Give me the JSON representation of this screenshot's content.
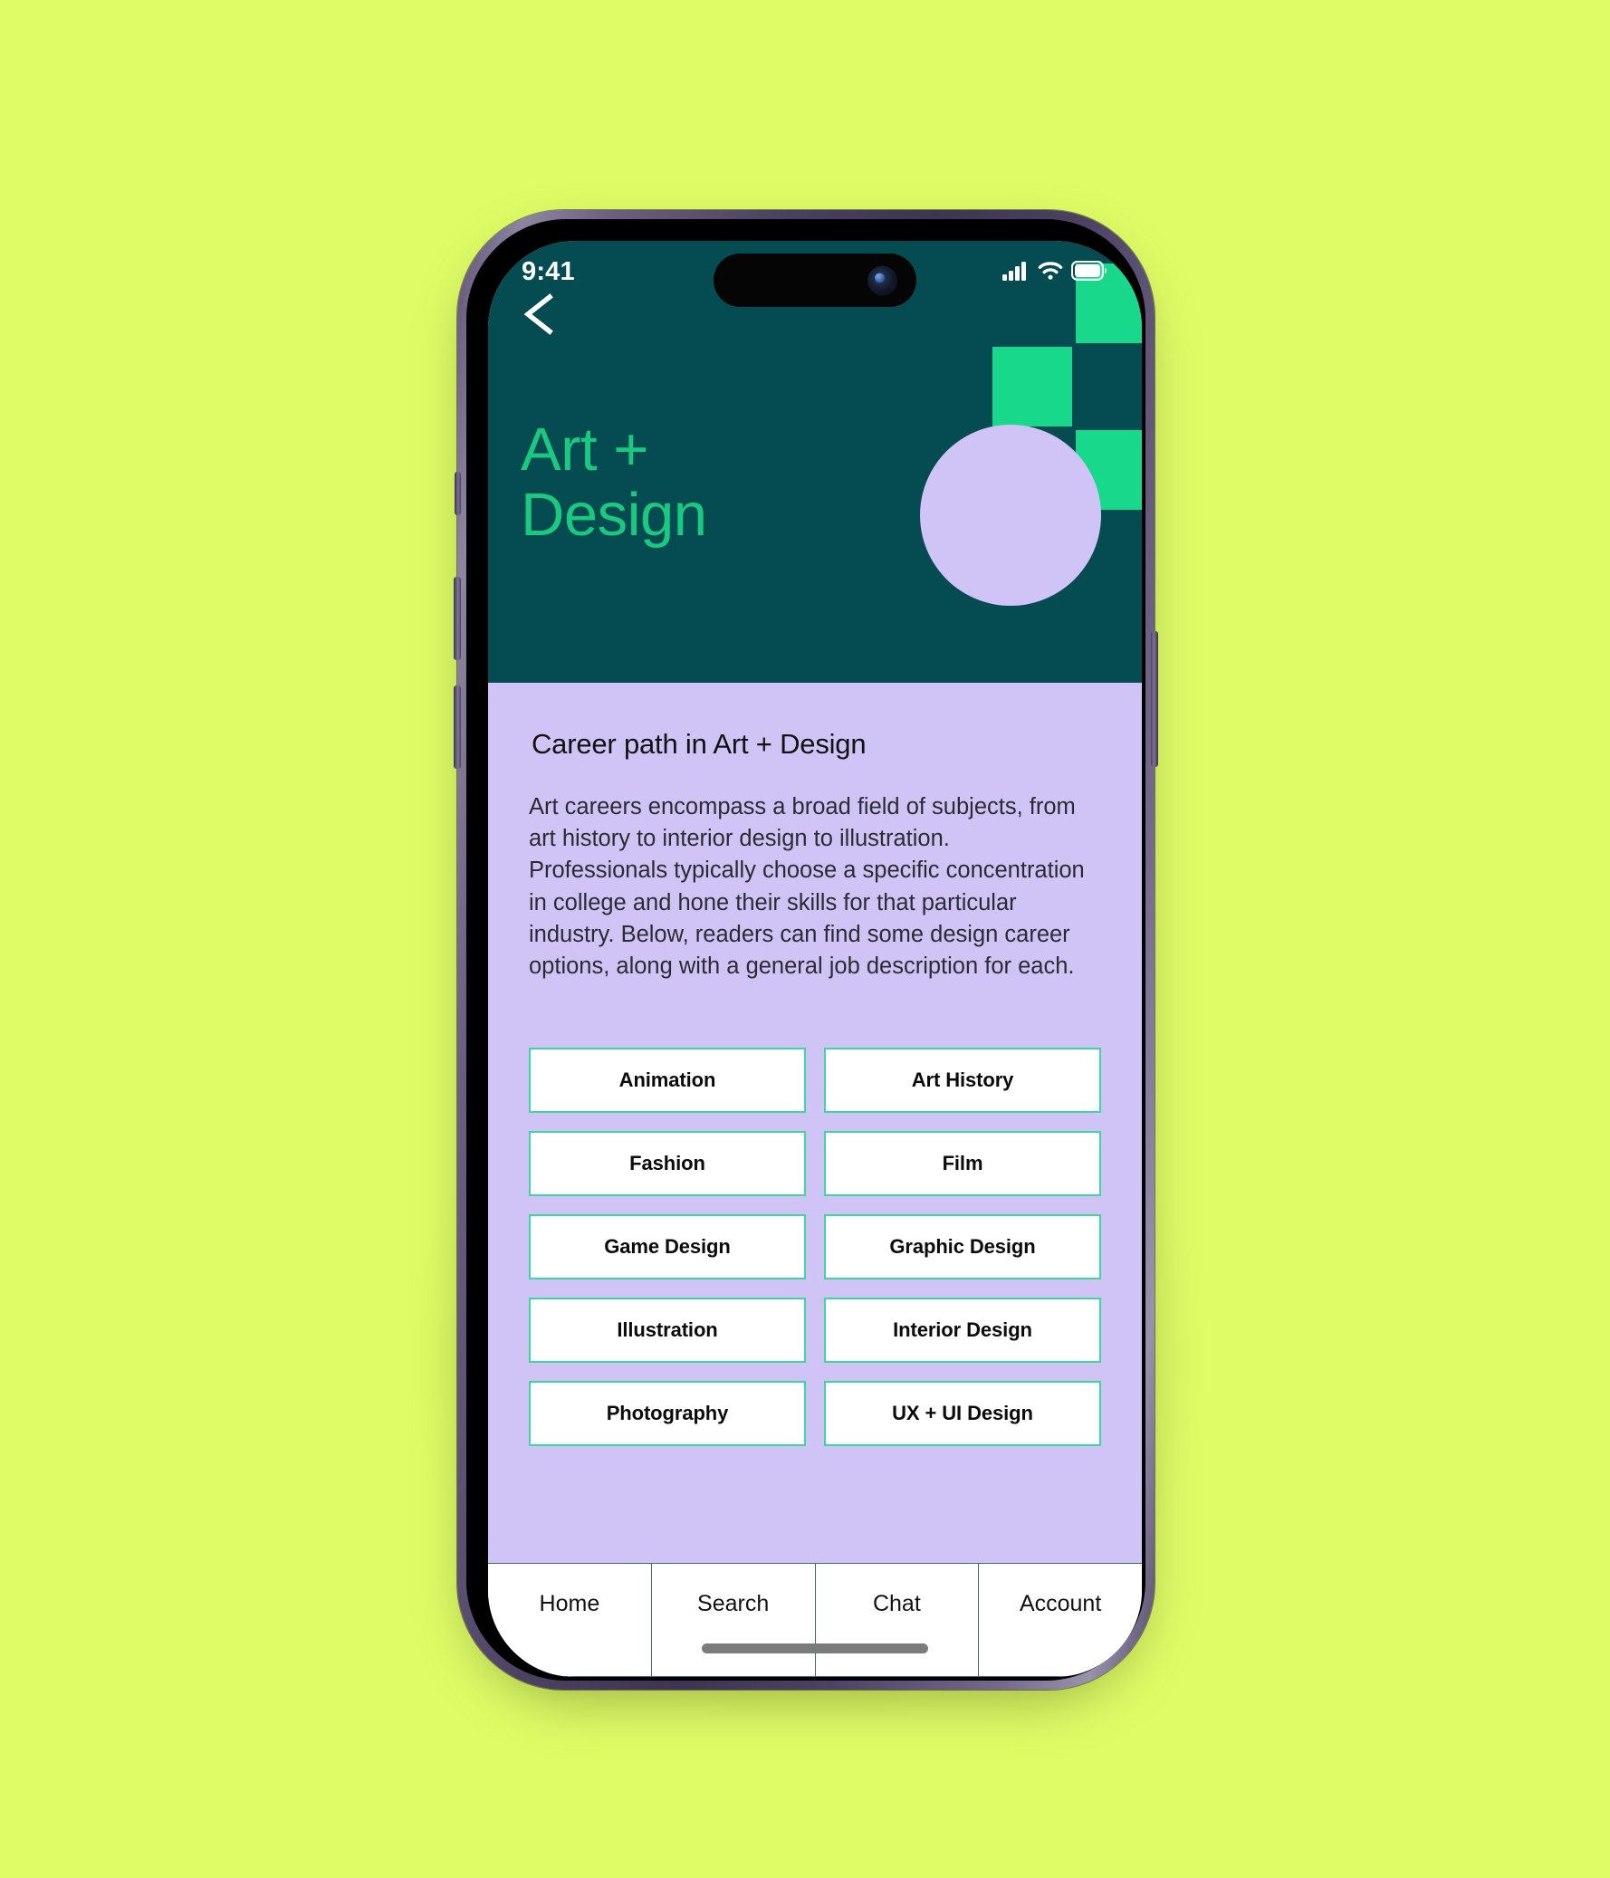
{
  "theme": {
    "page_background": "#DFFC66",
    "hero_background": "#054B52",
    "hero_accent_green": "#18D98B",
    "hero_title_color": "#18C97F",
    "content_background": "#CFC4F5",
    "chip_border": "#3BD79B",
    "chip_background": "#FFFFFF",
    "tabbar_background": "#FFFFFF",
    "tabbar_divider": "#3F6B70"
  },
  "status_bar": {
    "time": "9:41",
    "icons": [
      "cellular-signal-icon",
      "wifi-icon",
      "battery-icon"
    ]
  },
  "hero": {
    "back_icon": "chevron-left-icon",
    "title_line1": "Art +",
    "title_line2": "Design",
    "decor": [
      "green-square",
      "green-square",
      "green-square",
      "lavender-circle"
    ]
  },
  "content": {
    "heading": "Career path in Art + Design",
    "paragraph": "Art careers encompass a broad field of subjects, from art history to interior design to illustration. Professionals typically choose a specific concentration in college and hone their skills for that particular industry. Below, readers can find some design career options, along with a general job description for each.",
    "categories": [
      "Animation",
      "Art History",
      "Fashion",
      "Film",
      "Game Design",
      "Graphic Design",
      "Illustration",
      "Interior Design",
      "Photography",
      "UX + UI Design"
    ]
  },
  "tabbar": {
    "items": [
      "Home",
      "Search",
      "Chat",
      "Account"
    ]
  }
}
